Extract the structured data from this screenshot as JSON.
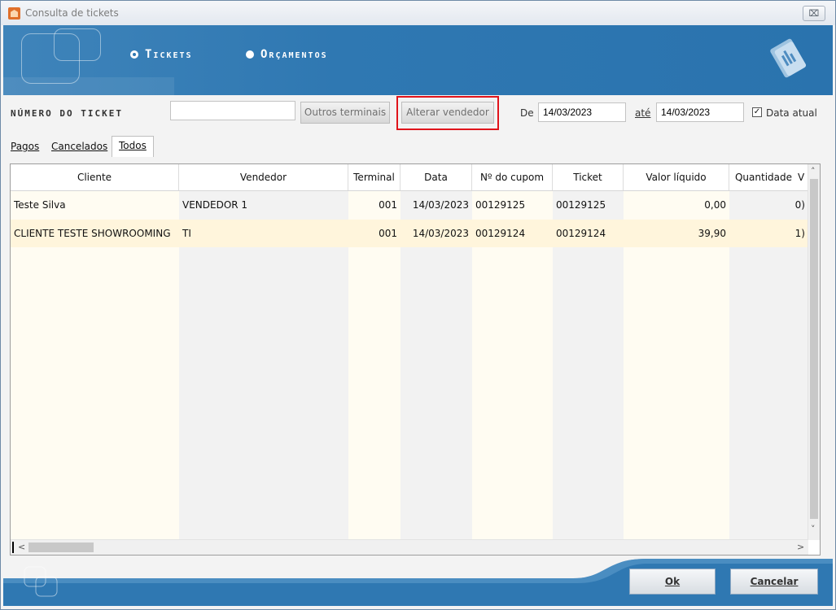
{
  "window": {
    "title": "Consulta de tickets",
    "close_label": "⌧"
  },
  "banner": {
    "radio_tickets": "Tickets",
    "radio_orcamentos": "Orçamentos"
  },
  "filters": {
    "ticket_label": "Número do ticket",
    "ticket_value": "",
    "outros_terminais": "Outros terminais",
    "alterar_vendedor": "Alterar vendedor",
    "de_label": "De",
    "de_value": "14/03/2023",
    "ate_label": "até",
    "ate_value": "14/03/2023",
    "data_atual_label": "Data atual",
    "data_atual_checked": true
  },
  "tabs": [
    {
      "label": "Pagos"
    },
    {
      "label": "Cancelados"
    },
    {
      "label": "Todos",
      "active": true
    }
  ],
  "grid": {
    "columns": [
      "Cliente",
      "Vendedor",
      "Terminal",
      "Data",
      "Nº do cupom",
      "Ticket",
      "Valor líquido",
      "Quantidade",
      "V"
    ],
    "rows": [
      {
        "cliente": "Teste Silva",
        "vendedor": "VENDEDOR 1",
        "terminal": "001",
        "data": "14/03/2023",
        "cupom": "00129125",
        "ticket": "00129125",
        "valor": "0,00",
        "quantidade": "0)"
      },
      {
        "cliente": "CLIENTE TESTE SHOWROOMING",
        "vendedor": "TI",
        "terminal": "001",
        "data": "14/03/2023",
        "cupom": "00129124",
        "ticket": "00129124",
        "valor": "39,90",
        "quantidade": "1)"
      }
    ]
  },
  "footer": {
    "ok": "Ok",
    "cancelar": "Cancelar"
  },
  "colors": {
    "banner": "#2f78b2",
    "highlight": "#e0141b",
    "selected_row": "#fff5dc"
  }
}
